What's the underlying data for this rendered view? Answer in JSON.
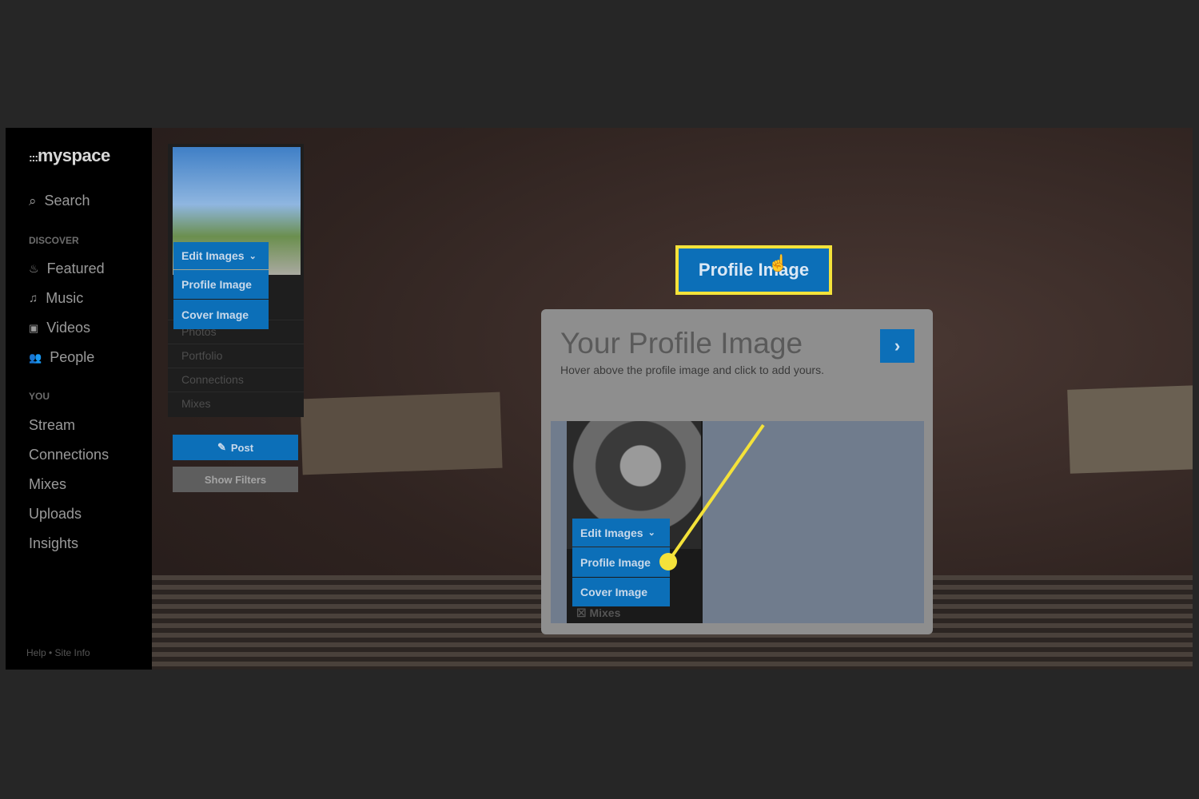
{
  "sidebar": {
    "logo": "myspace",
    "search": "Search",
    "discover_heading": "DISCOVER",
    "discover": [
      {
        "label": "Featured",
        "icon": "flame-icon"
      },
      {
        "label": "Music",
        "icon": "music-note-icon"
      },
      {
        "label": "Videos",
        "icon": "video-icon"
      },
      {
        "label": "People",
        "icon": "people-icon"
      }
    ],
    "you_heading": "YOU",
    "you": [
      "Stream",
      "Connections",
      "Mixes",
      "Uploads",
      "Insights"
    ],
    "footer": "Help • Site Info"
  },
  "profile_panel": {
    "edit_images": "Edit Images",
    "menu": [
      "Profile Image",
      "Cover Image"
    ],
    "links": [
      "Photos",
      "Portfolio",
      "Connections",
      "Mixes"
    ],
    "post": "Post",
    "show_filters": "Show Filters"
  },
  "modal": {
    "title": "Your Profile Image",
    "subtitle": "Hover above the profile image and click to add yours.",
    "next": "›",
    "edit_images": "Edit Images",
    "menu": [
      "Profile Image",
      "Cover Image"
    ],
    "mixes": "Mixes"
  },
  "callout": {
    "label": "Profile Image",
    "color": "#f4e23a"
  },
  "colors": {
    "accent": "#0c6fb8",
    "highlight": "#f4e23a"
  }
}
